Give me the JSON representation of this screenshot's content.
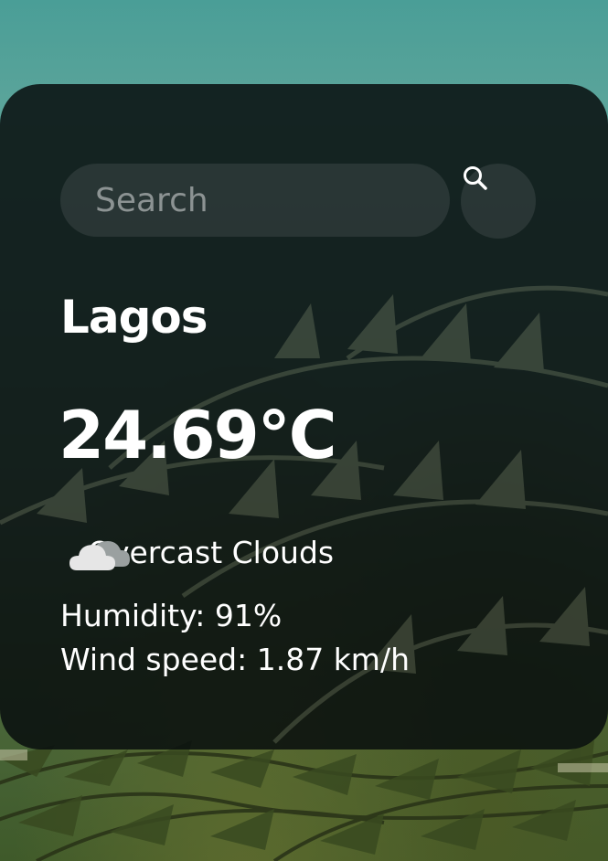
{
  "search": {
    "placeholder": "Search",
    "value": "",
    "button_icon": "search-icon"
  },
  "weather": {
    "city": "Lagos",
    "temperature": "24.69°C",
    "condition_icon": "cloud-icon",
    "condition": "Overcast Clouds",
    "humidity": "Humidity: 91%",
    "wind_speed": "Wind speed: 1.87 km/h"
  },
  "colors": {
    "card_background": "#080e0e",
    "text": "#ffffff",
    "placeholder": "#8c9393",
    "sky": "#4a9e97",
    "foliage": "#4d6a3e"
  }
}
